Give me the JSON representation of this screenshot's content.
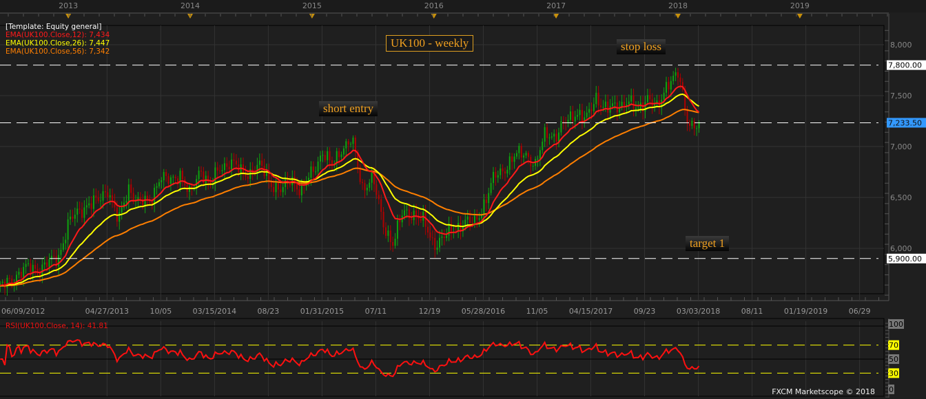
{
  "chart_data": {
    "type": "candlestick",
    "title": "UK100 - weekly",
    "template": "[Template: Equity general]",
    "indicators": [
      {
        "label": "EMA(UK100.Close,12): 7,434",
        "period": 12,
        "color": "#ff1a1a"
      },
      {
        "label": "EMA(UK100.Close,26): 7,447",
        "period": 26,
        "color": "#ffff00"
      },
      {
        "label": "EMA(UK100.Close,56): 7,342",
        "period": 56,
        "color": "#ff7f00"
      }
    ],
    "rsi": {
      "label": "RSI(UK100.Close, 14): 41.81",
      "period": 14,
      "levels": [
        "100",
        "70",
        "50",
        "30",
        "0"
      ],
      "last": 41.81
    },
    "monthly_closes_start": "2012-06",
    "monthly_closes": [
      5600,
      5650,
      5750,
      5800,
      5800,
      5850,
      5900,
      6250,
      6350,
      6450,
      6450,
      6600,
      6250,
      6600,
      6450,
      6450,
      6700,
      6650,
      6750,
      6500,
      6800,
      6600,
      6800,
      6850,
      6750,
      6750,
      6800,
      6650,
      6550,
      6700,
      6550,
      6750,
      6950,
      6800,
      7000,
      7050,
      6600,
      6700,
      6250,
      6050,
      6350,
      6350,
      6250,
      6050,
      6100,
      6200,
      6250,
      6250,
      6450,
      6700,
      6800,
      6900,
      6950,
      6800,
      7150,
      7100,
      7250,
      7350,
      7250,
      7500,
      7350,
      7400,
      7450,
      7350,
      7500,
      7350,
      7650,
      7700,
      7230
    ],
    "y_ticks": [
      "8,000",
      "7,500",
      "7,000",
      "6,500",
      "6,000"
    ],
    "y_tick_values": [
      8000,
      7500,
      7000,
      6500,
      6000
    ],
    "ylim": [
      5480,
      8140
    ],
    "x_labels": [
      "06/09/2012",
      "04/27/2013",
      "10/05",
      "03/15/2014",
      "08/23",
      "01/31/2015",
      "07/11",
      "12/19",
      "05/28/2016",
      "11/05",
      "04/15/2017",
      "09/23",
      "03/03/2018",
      "08/11",
      "01/19/2019",
      "06/29"
    ],
    "x_label_dates": [
      "2012-06-09",
      "2013-04-27",
      "2013-10-05",
      "2014-03-15",
      "2014-08-23",
      "2015-01-31",
      "2015-07-11",
      "2015-12-19",
      "2016-05-28",
      "2016-11-05",
      "2017-04-15",
      "2017-09-23",
      "2018-03-03",
      "2018-08-11",
      "2019-01-19",
      "2019-06-29"
    ],
    "years": [
      "2013",
      "2014",
      "2015",
      "2016",
      "2017",
      "2018",
      "2019"
    ],
    "hlines": [
      {
        "value": 7800,
        "label": "7,800.00",
        "note": "stop loss"
      },
      {
        "value": 7233.5,
        "label": "7,233.50",
        "note": "short entry"
      },
      {
        "value": 5900,
        "label": "5,900.00",
        "note": "target 1"
      }
    ],
    "colors": {
      "up": "#0ea50e",
      "down": "#b00000",
      "current": "#3399ff"
    }
  },
  "footer": "FXCM Marketscope © 2018"
}
